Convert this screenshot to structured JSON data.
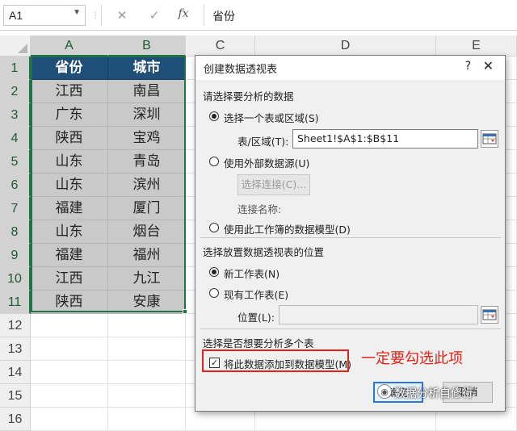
{
  "formula_bar": {
    "name_box": "A1",
    "cancel_icon": "✕",
    "enter_icon": "✓",
    "fx_label": "fx",
    "formula": "省份"
  },
  "columns": [
    "A",
    "B",
    "C",
    "D",
    "E"
  ],
  "rows": [
    "1",
    "2",
    "3",
    "4",
    "5",
    "6",
    "7",
    "8",
    "9",
    "10",
    "11",
    "12",
    "13",
    "14",
    "15",
    "16"
  ],
  "table": {
    "headers": [
      "省份",
      "城市"
    ],
    "rows": [
      [
        "江西",
        "南昌"
      ],
      [
        "广东",
        "深圳"
      ],
      [
        "陕西",
        "宝鸡"
      ],
      [
        "山东",
        "青岛"
      ],
      [
        "山东",
        "滨州"
      ],
      [
        "福建",
        "厦门"
      ],
      [
        "山东",
        "烟台"
      ],
      [
        "福建",
        "福州"
      ],
      [
        "江西",
        "九江"
      ],
      [
        "陕西",
        "安康"
      ]
    ]
  },
  "dialog": {
    "title": "创建数据透视表",
    "help_icon": "?",
    "close_icon": "✕",
    "section_choose_data": "请选择要分析的数据",
    "radio_table_range": "选择一个表或区域(S)",
    "range_label": "表/区域(T):",
    "range_value": "Sheet1!$A$1:$B$11",
    "radio_external": "使用外部数据源(U)",
    "choose_connection_button": "选择连接(C)...",
    "connection_name_label": "连接名称:",
    "radio_data_model": "使用此工作簿的数据模型(D)",
    "section_placement": "选择放置数据透视表的位置",
    "radio_new_sheet": "新工作表(N)",
    "radio_existing_sheet": "现有工作表(E)",
    "location_label": "位置(L):",
    "location_value": "",
    "section_multiple_tables": "选择是否想要分析多个表",
    "checkbox_add_to_model": "将此数据添加到数据模型(M)",
    "checkbox_checked": true,
    "ok_button": "确定",
    "cancel_button": "取消"
  },
  "annotation": "一定要勾选此项",
  "watermark": "数据分析自修行",
  "colors": {
    "header_fill": "#1f4e79",
    "data_fill": "#c9c9c9",
    "selection": "#217346",
    "annotation_red": "#e0231a"
  }
}
